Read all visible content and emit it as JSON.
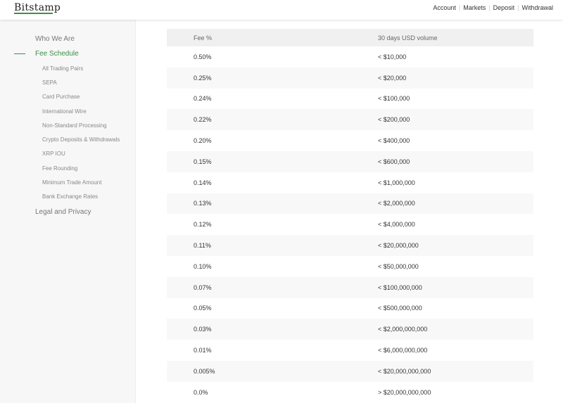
{
  "header": {
    "logo": "Bitstamp",
    "nav": [
      "Account",
      "Markets",
      "Deposit",
      "Withdrawal"
    ]
  },
  "sidebar": {
    "who_we_are": "Who We Are",
    "fee_schedule": "Fee Schedule",
    "sub_items": [
      "All Trading Pairs",
      "SEPA",
      "Card Purchase",
      "International Wire",
      "Non-Standard Processing",
      "Crypto Deposits & Withdrawals",
      "XRP IOU",
      "Fee Rounding",
      "Minimum Trade Amount",
      "Bank Exchange Rates"
    ],
    "legal": "Legal and Privacy"
  },
  "table": {
    "headers": [
      "Fee %",
      "30 days USD volume"
    ],
    "rows": [
      [
        "0.50%",
        "< $10,000"
      ],
      [
        "0.25%",
        "< $20,000"
      ],
      [
        "0.24%",
        "< $100,000"
      ],
      [
        "0.22%",
        "< $200,000"
      ],
      [
        "0.20%",
        "< $400,000"
      ],
      [
        "0.15%",
        "< $600,000"
      ],
      [
        "0.14%",
        "< $1,000,000"
      ],
      [
        "0.13%",
        "< $2,000,000"
      ],
      [
        "0.12%",
        "< $4,000,000"
      ],
      [
        "0.11%",
        "< $20,000,000"
      ],
      [
        "0.10%",
        "< $50,000,000"
      ],
      [
        "0.07%",
        "< $100,000,000"
      ],
      [
        "0.05%",
        "< $500,000,000"
      ],
      [
        "0.03%",
        "< $2,000,000,000"
      ],
      [
        "0.01%",
        "< $6,000,000,000"
      ],
      [
        "0.005%",
        "< $20,000,000,000"
      ],
      [
        "0.0%",
        "> $20,000,000,000"
      ]
    ]
  },
  "colors": {
    "accent": "#3a8f4a",
    "sidebar_bg": "#f7f7f7",
    "header_row_bg": "#f0f0f0",
    "alt_row_bg": "#f8f8f8"
  }
}
